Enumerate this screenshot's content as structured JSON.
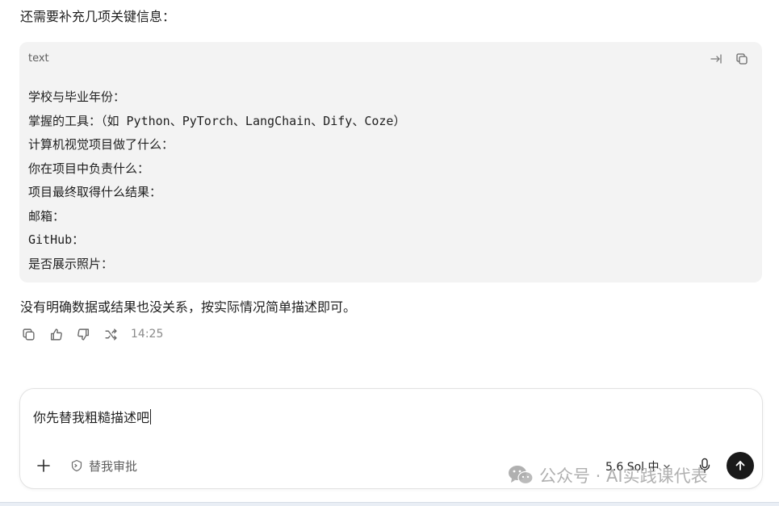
{
  "message": {
    "intro": "还需要补充几项关键信息：",
    "code_block": {
      "language": "text",
      "lines": [
        "学校与毕业年份：",
        "掌握的工具：（如 Python、PyTorch、LangChain、Dify、Coze）",
        "计算机视觉项目做了什么：",
        "你在项目中负责什么：",
        "项目最终取得什么结果：",
        "邮箱：",
        "GitHub：",
        "是否展示照片："
      ]
    },
    "note": "没有明确数据或结果也没关系，按实际情况简单描述即可。",
    "timestamp": "14:25"
  },
  "composer": {
    "value": "你先替我粗糙描述吧",
    "shortcut_label": "替我审批",
    "model_label": "5.6 Sol 中"
  },
  "watermark": {
    "text": "公众号 · AI实践课代表"
  },
  "icons": {
    "wrap": "wrap-icon",
    "copy": "copy-icon",
    "thumbs_up": "thumbs-up-icon",
    "thumbs_down": "thumbs-down-icon",
    "share": "share-icon",
    "plus": "plus-icon",
    "shortcut": "terminal-badge-icon",
    "mic": "mic-icon",
    "send": "arrow-up-icon"
  }
}
